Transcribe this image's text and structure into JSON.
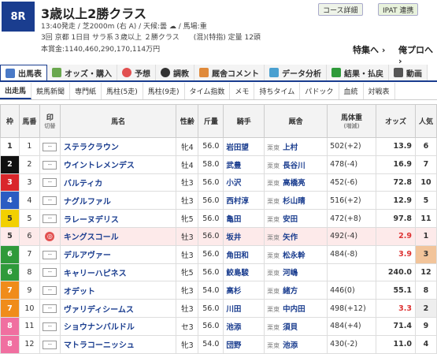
{
  "race": {
    "number": "8R",
    "title": "3歳以上2勝クラス",
    "info1": "13:40発走 / 芝2000m (右 A) / 天候:曇 ☁ / 馬場:重",
    "info2": "3回 京都 1日目 サラ系３歳以上 ２勝クラス　　(混)(特指) 定量 12頭",
    "info3": "本賞金:1140,460,290,170,114万円"
  },
  "buttons": {
    "course": "コース詳細",
    "ipat": "IPAT 連携",
    "feature": "特集へ ›",
    "mylist": "俺プロへ ›"
  },
  "tabs": [
    "出馬表",
    "オッズ・購入",
    "予想",
    "調教",
    "厩舎コメント",
    "データ分析",
    "結果・払戻",
    "動画"
  ],
  "subtabs": [
    "出走馬",
    "競馬新聞",
    "専門紙",
    "馬柱(5走)",
    "馬柱(9走)",
    "タイム指数",
    "メモ",
    "持ちタイム",
    "パドック",
    "血統",
    "対戦表"
  ],
  "headers": {
    "waku": "枠",
    "umaban": "馬番",
    "mark": "印",
    "switch": "切替",
    "name": "馬名",
    "sex_age": "性齢",
    "weight": "斤量",
    "jockey": "騎手",
    "trainer": "厩舎",
    "body_weight": "馬体重",
    "body_weight_sub": "(増減)",
    "odds": "オッズ",
    "popularity": "人気"
  },
  "rows": [
    {
      "waku": "1",
      "num": "1",
      "name": "ステラクラウン",
      "sa": "牝4",
      "kin": "56.0",
      "jockey": "岩田望",
      "aff": "栗東",
      "trainer": "上村",
      "bw": "502(+2)",
      "odds": "13.9",
      "pop": "6"
    },
    {
      "waku": "2",
      "num": "2",
      "name": "ウイントレメンデス",
      "sa": "牡4",
      "kin": "58.0",
      "jockey": "武豊",
      "aff": "栗東",
      "trainer": "長谷川",
      "bw": "478(-4)",
      "odds": "16.9",
      "pop": "7"
    },
    {
      "waku": "3",
      "num": "3",
      "name": "バルティカ",
      "sa": "牡3",
      "kin": "56.0",
      "jockey": "小沢",
      "aff": "栗東",
      "trainer": "高橋亮",
      "bw": "452(-6)",
      "odds": "72.8",
      "pop": "10"
    },
    {
      "waku": "4",
      "num": "4",
      "name": "ナグルファル",
      "sa": "牡3",
      "kin": "56.0",
      "jockey": "西村淳",
      "aff": "栗東",
      "trainer": "杉山晴",
      "bw": "516(+2)",
      "odds": "12.9",
      "pop": "5"
    },
    {
      "waku": "5",
      "num": "5",
      "name": "ラレーヌデリス",
      "sa": "牝5",
      "kin": "56.0",
      "jockey": "亀田",
      "aff": "栗東",
      "trainer": "安田",
      "bw": "472(+8)",
      "odds": "97.8",
      "pop": "11"
    },
    {
      "waku": "5",
      "num": "6",
      "name": "キングスコール",
      "sa": "牡3",
      "kin": "56.0",
      "jockey": "坂井",
      "aff": "栗東",
      "trainer": "矢作",
      "bw": "492(-4)",
      "odds": "2.9",
      "pop": "1",
      "sel": true
    },
    {
      "waku": "6",
      "num": "7",
      "name": "デルアヴァー",
      "sa": "牡3",
      "kin": "56.0",
      "jockey": "角田和",
      "aff": "栗東",
      "trainer": "松永幹",
      "bw": "484(-8)",
      "odds": "3.9",
      "pop": "3"
    },
    {
      "waku": "6",
      "num": "8",
      "name": "キャリーハピネス",
      "sa": "牝5",
      "kin": "56.0",
      "jockey": "鮫島駿",
      "aff": "栗東",
      "trainer": "河嶋",
      "bw": "",
      "odds": "240.0",
      "pop": "12"
    },
    {
      "waku": "7",
      "num": "9",
      "name": "オデット",
      "sa": "牝3",
      "kin": "54.0",
      "jockey": "高杉",
      "aff": "栗東",
      "trainer": "緒方",
      "bw": "446(0)",
      "odds": "55.1",
      "pop": "8"
    },
    {
      "waku": "7",
      "num": "10",
      "name": "ヴァリディシームス",
      "sa": "牡3",
      "kin": "56.0",
      "jockey": "川田",
      "aff": "栗東",
      "trainer": "中内田",
      "bw": "498(+12)",
      "odds": "3.3",
      "pop": "2"
    },
    {
      "waku": "8",
      "num": "11",
      "name": "ショウナンバルドル",
      "sa": "セ3",
      "kin": "56.0",
      "jockey": "池添",
      "aff": "栗東",
      "trainer": "須貝",
      "bw": "484(+4)",
      "odds": "71.4",
      "pop": "9"
    },
    {
      "waku": "8",
      "num": "12",
      "name": "マトラコーニッシュ",
      "sa": "牝3",
      "kin": "54.0",
      "jockey": "団野",
      "aff": "栗東",
      "trainer": "池添",
      "bw": "430(-2)",
      "odds": "11.0",
      "pop": "4"
    }
  ]
}
